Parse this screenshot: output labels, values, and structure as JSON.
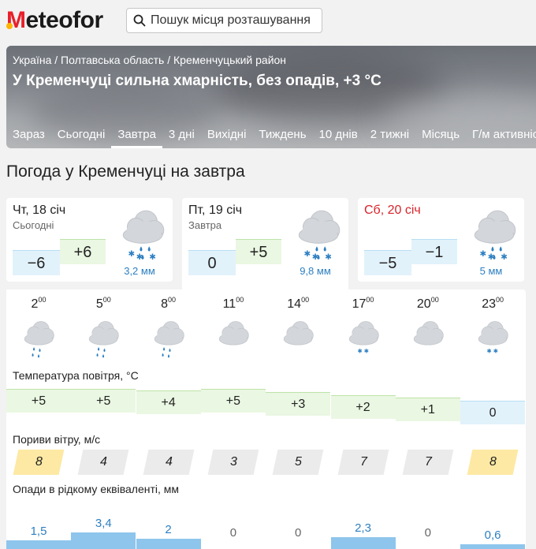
{
  "site": {
    "logo_m": "M",
    "logo_rest": "eteofor"
  },
  "search": {
    "placeholder": "Пошук місця розташування"
  },
  "breadcrumb": [
    "Україна",
    "Полтавська область",
    "Кременчуцький район"
  ],
  "headline": "У Кременчуці сильна хмарність, без опадів, +3 °C",
  "tabs": [
    "Зараз",
    "Сьогодні",
    "Завтра",
    "3 дні",
    "Вихідні",
    "Тиждень",
    "10 днів",
    "2 тижні",
    "Місяць",
    "Г/м активність"
  ],
  "active_tab": "Завтра",
  "page_title": "Погода у Кременчуці на завтра",
  "days": [
    {
      "name": "Чт, 18 січ",
      "sub": "Сьогодні",
      "min": "−6",
      "max": "+6",
      "precip": "3,2 мм",
      "weekend": false,
      "selected": false,
      "icon": "cloud-snow-rain-icon"
    },
    {
      "name": "Пт, 19 січ",
      "sub": "Завтра",
      "min": "0",
      "max": "+5",
      "precip": "9,8 мм",
      "weekend": false,
      "selected": true,
      "icon": "cloud-snow-rain-icon"
    },
    {
      "name": "Сб, 20 січ",
      "sub": "",
      "min": "−5",
      "max": "−1",
      "precip": "5 мм",
      "weekend": true,
      "selected": false,
      "icon": "cloud-snow-rain-icon"
    }
  ],
  "hourly": {
    "hours": [
      {
        "h": "2",
        "m": "00"
      },
      {
        "h": "5",
        "m": "00"
      },
      {
        "h": "8",
        "m": "00"
      },
      {
        "h": "11",
        "m": "00"
      },
      {
        "h": "14",
        "m": "00"
      },
      {
        "h": "17",
        "m": "00"
      },
      {
        "h": "20",
        "m": "00"
      },
      {
        "h": "23",
        "m": "00"
      }
    ],
    "icons": [
      "cloud-rain-icon",
      "cloud-rain-icon",
      "cloud-rain-icon",
      "cloud-icon",
      "cloud-icon",
      "cloud-snow-icon",
      "cloud-icon",
      "cloud-snow-icon"
    ],
    "temp_label": "Температура повітря, °C",
    "temps": [
      "+5",
      "+5",
      "+4",
      "+5",
      "+3",
      "+2",
      "+1",
      "0"
    ],
    "gust_label": "Пориви вітру, м/с",
    "gusts": [
      "8",
      "4",
      "4",
      "3",
      "5",
      "7",
      "7",
      "8"
    ],
    "gust_highlight": [
      true,
      false,
      false,
      false,
      false,
      false,
      false,
      true
    ],
    "precip_label": "Опади в рідкому еквіваленті, мм",
    "precip": [
      "1,5",
      "3,4",
      "2",
      "0",
      "0",
      "2,3",
      "0",
      "0,6"
    ],
    "precip_values": [
      1.5,
      3.4,
      2,
      0,
      0,
      2.3,
      0,
      0.6
    ]
  },
  "colors": {
    "warm": "#eaf7e2",
    "cold": "#e2f2fb",
    "rain": "#2d7fc1",
    "weekend": "#d8232a",
    "logo": "#e8202a",
    "gust_high": "#fde9a3"
  }
}
